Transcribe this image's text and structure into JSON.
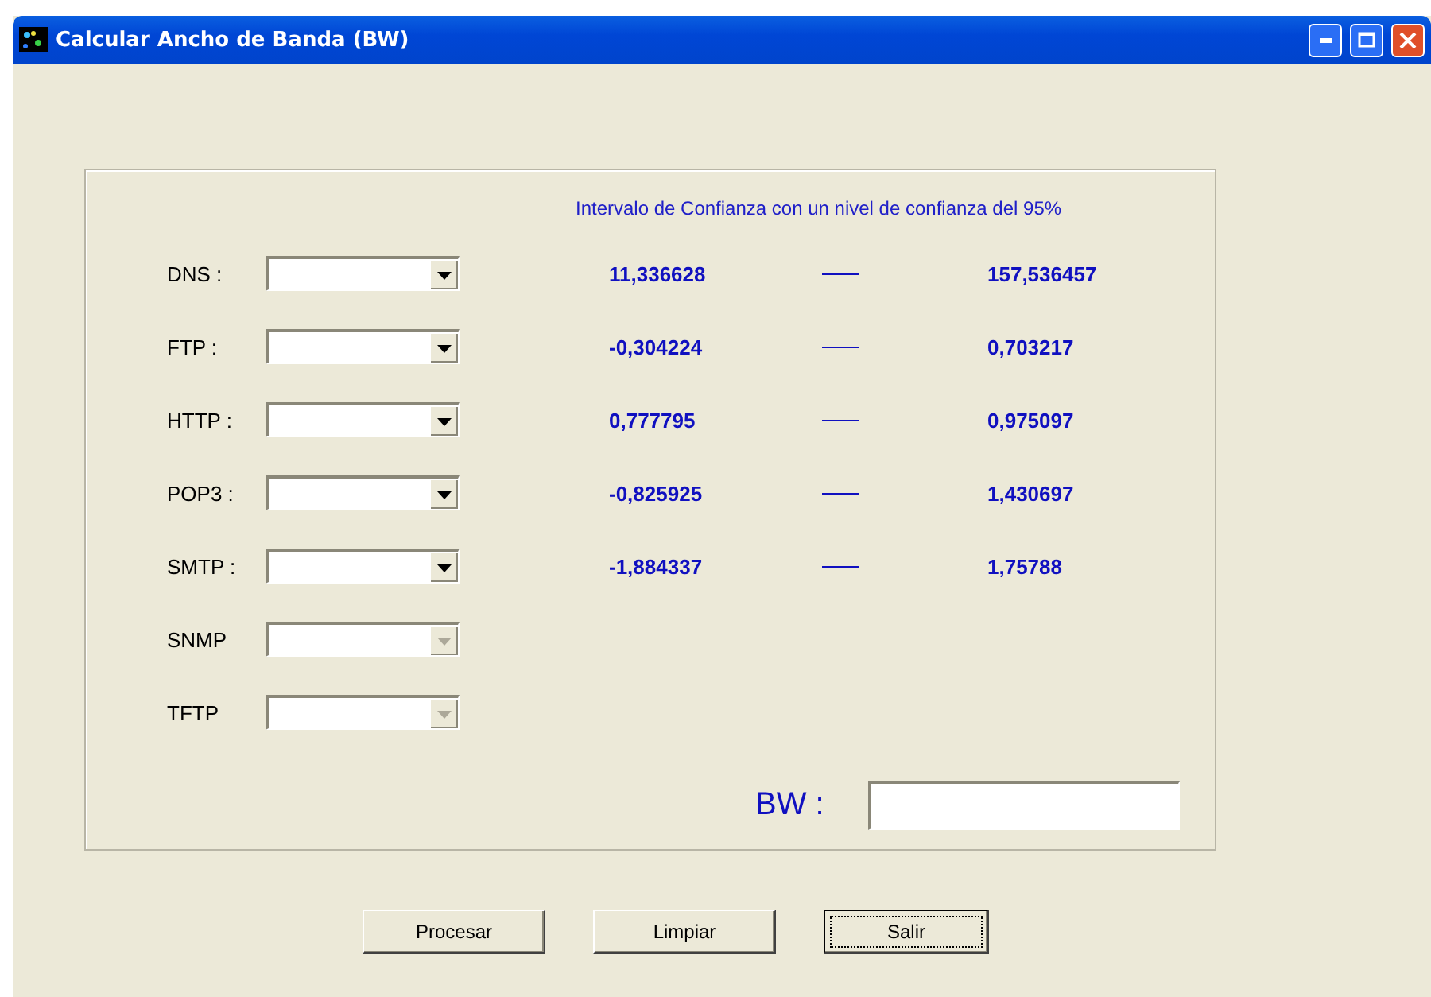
{
  "window": {
    "title": "Calcular Ancho de Banda (BW)"
  },
  "interval_heading": "Intervalo de Confianza con un nivel de confianza del 95%",
  "protocols": [
    {
      "label": "DNS :",
      "enabled": true,
      "lower": "11,336628",
      "upper": "157,536457"
    },
    {
      "label": "FTP :",
      "enabled": true,
      "lower": "-0,304224",
      "upper": "0,703217"
    },
    {
      "label": "HTTP :",
      "enabled": true,
      "lower": "0,777795",
      "upper": "0,975097"
    },
    {
      "label": "POP3 :",
      "enabled": true,
      "lower": "-0,825925",
      "upper": "1,430697"
    },
    {
      "label": "SMTP :",
      "enabled": true,
      "lower": "-1,884337",
      "upper": "1,75788"
    },
    {
      "label": "SNMP",
      "enabled": false
    },
    {
      "label": "TFTP",
      "enabled": false
    }
  ],
  "bw": {
    "label": "BW :"
  },
  "buttons": [
    {
      "label": "Procesar",
      "default": false
    },
    {
      "label": "Limpiar",
      "default": false
    },
    {
      "label": "Salir",
      "default": true
    }
  ]
}
